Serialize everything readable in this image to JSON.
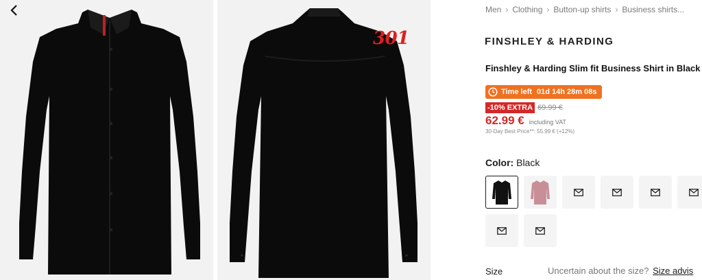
{
  "gallery": {
    "images": [
      {
        "view": "front",
        "icon": "black-shirt-front"
      },
      {
        "view": "back",
        "icon": "black-shirt-back"
      }
    ],
    "back_icon": "chevron-left-icon",
    "overlay_badge": "301",
    "overlay_color": "#e01e1e"
  },
  "breadcrumb": [
    "Men",
    "Clothing",
    "Button-up shirts",
    "Business shirts..."
  ],
  "product": {
    "brand": "FINSHLEY & HARDING",
    "title": "Finshley & Harding Slim fit Business Shirt in Black",
    "timer_label": "Time left",
    "timer_value": "01d 14h 28m 08s",
    "timer_color": "#f07120",
    "discount_badge": "-10% EXTRA",
    "old_price": "69.99 €",
    "price": "62.99 €",
    "price_color": "#d42828",
    "vat_note": "including VAT",
    "best_price_note": "30-Day Best Price**: 55.99 € (+12%)"
  },
  "color": {
    "label": "Color:",
    "value": "Black",
    "swatches": [
      {
        "type": "image",
        "shirt_color": "#111111",
        "selected": true
      },
      {
        "type": "image",
        "shirt_color": "#c98f98",
        "selected": false
      },
      {
        "type": "placeholder",
        "icon": "mail-icon",
        "selected": false
      },
      {
        "type": "placeholder",
        "icon": "mail-icon",
        "selected": false
      },
      {
        "type": "placeholder",
        "icon": "mail-icon",
        "selected": false
      },
      {
        "type": "placeholder",
        "icon": "mail-icon",
        "selected": false
      },
      {
        "type": "placeholder",
        "icon": "mail-icon",
        "selected": false
      },
      {
        "type": "placeholder",
        "icon": "mail-icon",
        "selected": false
      }
    ]
  },
  "size": {
    "label": "Size",
    "question": "Uncertain about the size?",
    "advisor_link": "Size advis"
  }
}
